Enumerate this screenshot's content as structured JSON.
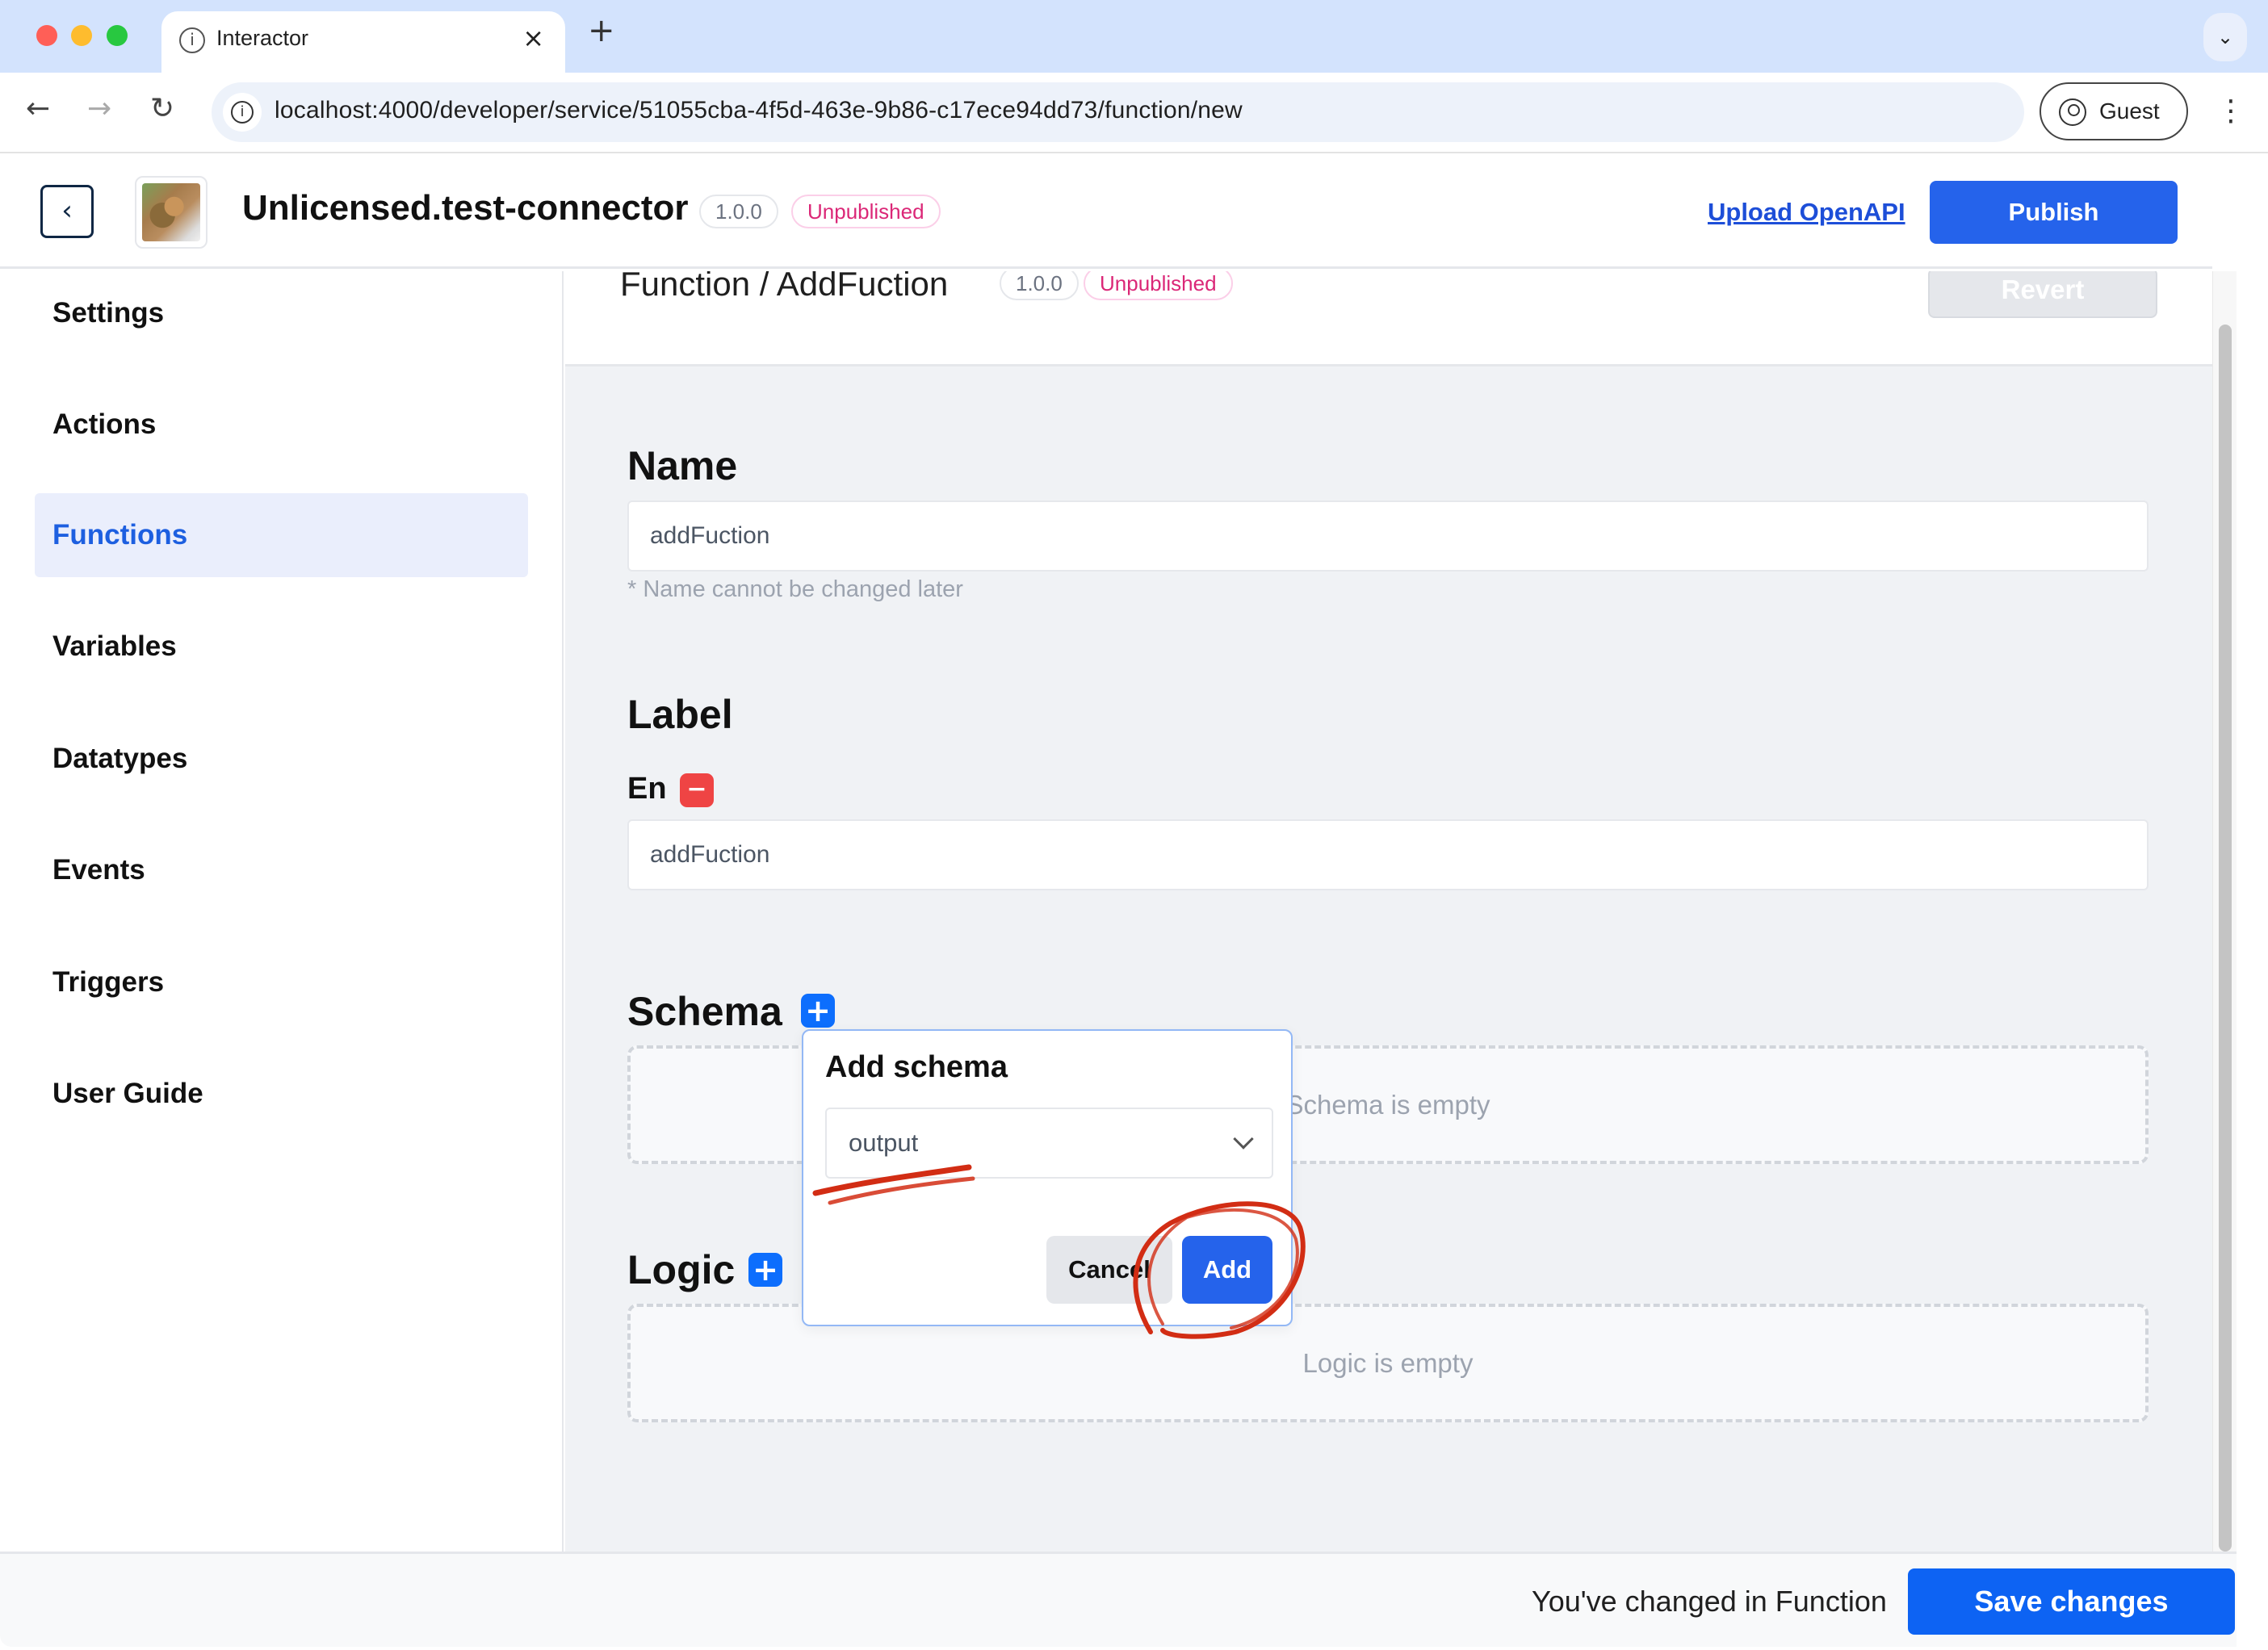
{
  "browser": {
    "tab_title": "Interactor",
    "tab_close": "×",
    "new_tab": "+",
    "tab_menu": "⌄",
    "url": "localhost:4000/developer/service/51055cba-4f5d-463e-9b86-c17ece94dd73/function/new",
    "profile": "Guest",
    "nav": {
      "back": "←",
      "forward": "→",
      "reload": "↻",
      "menu": "⋮",
      "info": "i"
    }
  },
  "header": {
    "back_icon": "‹",
    "app_name": "Unlicensed.test-connector",
    "version": "1.0.0",
    "status": "Unpublished",
    "upload_link": "Upload OpenAPI",
    "publish_label": "Publish"
  },
  "sidebar": {
    "items": [
      {
        "label": "Settings",
        "active": false
      },
      {
        "label": "Actions",
        "active": false
      },
      {
        "label": "Functions",
        "active": true
      },
      {
        "label": "Variables",
        "active": false
      },
      {
        "label": "Datatypes",
        "active": false
      },
      {
        "label": "Events",
        "active": false
      },
      {
        "label": "Triggers",
        "active": false
      },
      {
        "label": "User Guide",
        "active": false
      }
    ]
  },
  "subheader": {
    "breadcrumb": "Function / AddFuction",
    "version": "1.0.0",
    "status": "Unpublished",
    "revert_label": "Revert"
  },
  "form": {
    "name": {
      "heading": "Name",
      "value": "addFuction",
      "hint": "* Name cannot be changed later"
    },
    "label": {
      "heading": "Label",
      "lang": "En",
      "remove_icon": "−",
      "value": "addFuction"
    },
    "schema": {
      "heading": "Schema",
      "add_icon": "+",
      "empty_text": "Schema is empty"
    },
    "logic": {
      "heading": "Logic",
      "add_icon": "+",
      "empty_text": "Logic is empty"
    }
  },
  "popover": {
    "title": "Add schema",
    "selected": "output",
    "cancel_label": "Cancel",
    "add_label": "Add"
  },
  "footer": {
    "message": "You've changed in Function",
    "save_label": "Save changes"
  },
  "colors": {
    "primary": "#2563eb",
    "save": "#0d63f3",
    "unpublished": "#db2777",
    "danger": "#ef4444",
    "active_nav_bg": "#eaeefc",
    "annotation": "#d22d14"
  }
}
